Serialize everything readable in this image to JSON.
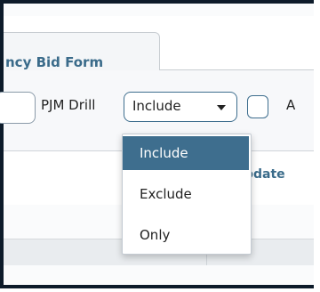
{
  "tab": {
    "label": "ncy Bid Form"
  },
  "toolbar": {
    "drill_label": "PJM Drill",
    "drill_select_value": "Include",
    "after_checkbox_label": "A"
  },
  "grid": {
    "update_header": "pdate"
  },
  "dropdown": {
    "options": [
      "Include",
      "Exclude",
      "Only"
    ],
    "selected_index": 0
  },
  "colors": {
    "accent": "#3e6e8e",
    "frame": "#0d1b2a",
    "annotation_arrow": "#e8221a",
    "tab_text": "#3a6b8a"
  }
}
